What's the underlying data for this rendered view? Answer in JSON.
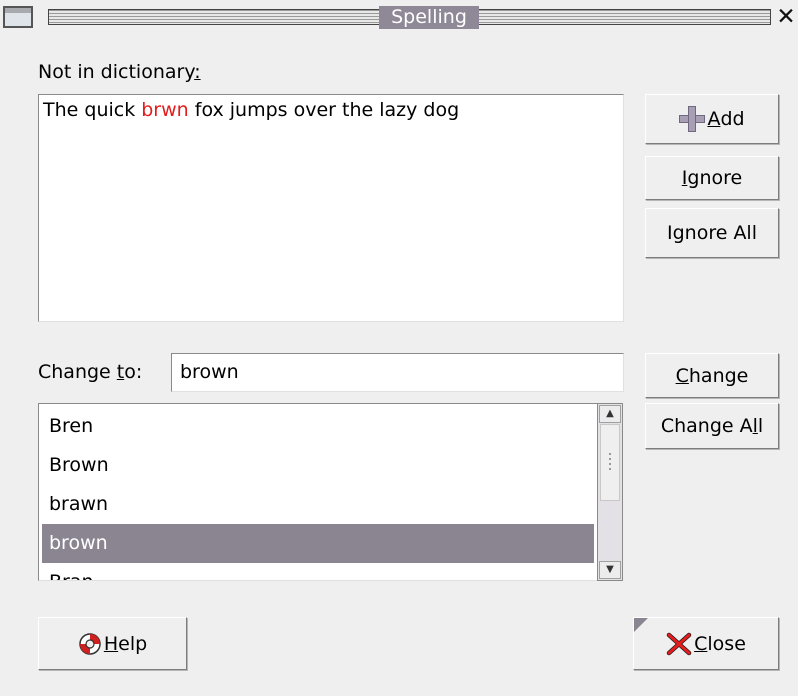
{
  "window": {
    "title": "Spelling",
    "close_glyph": "✕"
  },
  "labels": {
    "not_in_dictionary_prefix": "Not in dictionary",
    "not_in_dictionary_colon": ":",
    "change_to_pre": "Change ",
    "change_to_mn": "t",
    "change_to_post": "o:"
  },
  "sentence": {
    "before": "The quick ",
    "misspelled": "brwn",
    "after": " fox jumps over the lazy dog"
  },
  "change_to": {
    "value": "brown"
  },
  "suggestions": [
    {
      "text": "Bren",
      "selected": false
    },
    {
      "text": "Brown",
      "selected": false
    },
    {
      "text": "brawn",
      "selected": false
    },
    {
      "text": "brown",
      "selected": true
    },
    {
      "text": "Bran",
      "selected": false
    }
  ],
  "buttons": {
    "add_mn": "A",
    "add_rest": "dd",
    "ignore_mn": "I",
    "ignore_rest": "gnore",
    "ignore_all": "Ignore All",
    "change_mn": "C",
    "change_rest": "hange",
    "change_all_pre": "Change A",
    "change_all_mn": "l",
    "change_all_post": "l",
    "help_mn": "H",
    "help_rest": "elp",
    "close_mn": "C",
    "close_rest": "lose"
  },
  "colors": {
    "misspelled": "#e21d1d",
    "selection": "#8b8592",
    "title_highlight": "#8f8896"
  },
  "icons": {
    "add": "plus-icon",
    "help": "lifebuoy-icon",
    "close": "red-x-icon",
    "window": "window-menu-icon"
  }
}
